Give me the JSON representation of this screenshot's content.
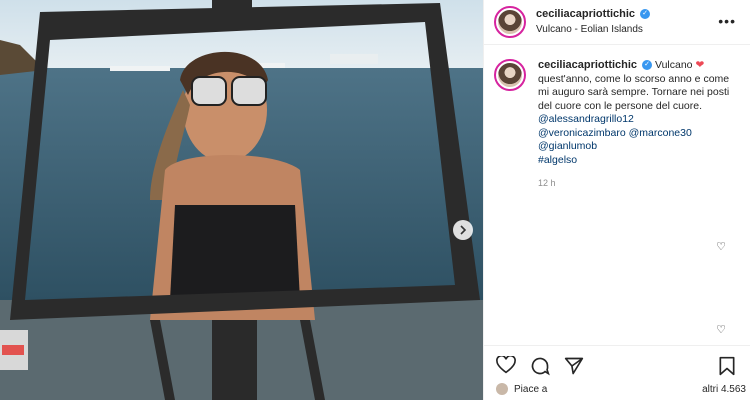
{
  "header": {
    "username": "ceciliacapriottichic",
    "location": "Vulcano - Eolian Islands",
    "more": "•••"
  },
  "caption": {
    "username": "ceciliacapriottichic",
    "first": "Vulcano",
    "heart": "❤",
    "text": "quest'anno, come lo scorso anno e come mi auguro sarà sempre. Tornare nei posti del cuore con le persone del cuore.",
    "mentions": [
      "@alessandragrillo12",
      "@veronicazimbaro @marcone30",
      "@gianlumob",
      "#algelso"
    ],
    "time": "12 h"
  },
  "likes": {
    "left": "Piace a",
    "right": "altri 4.563"
  },
  "icons": {
    "like": "heart-outline-icon",
    "comment": "comment-bubble-icon",
    "share": "paper-plane-icon",
    "save": "bookmark-icon",
    "next": "chevron-right-icon"
  },
  "colors": {
    "accent": "#3897f0",
    "heart": "#ed4956",
    "mention": "#00376b"
  }
}
